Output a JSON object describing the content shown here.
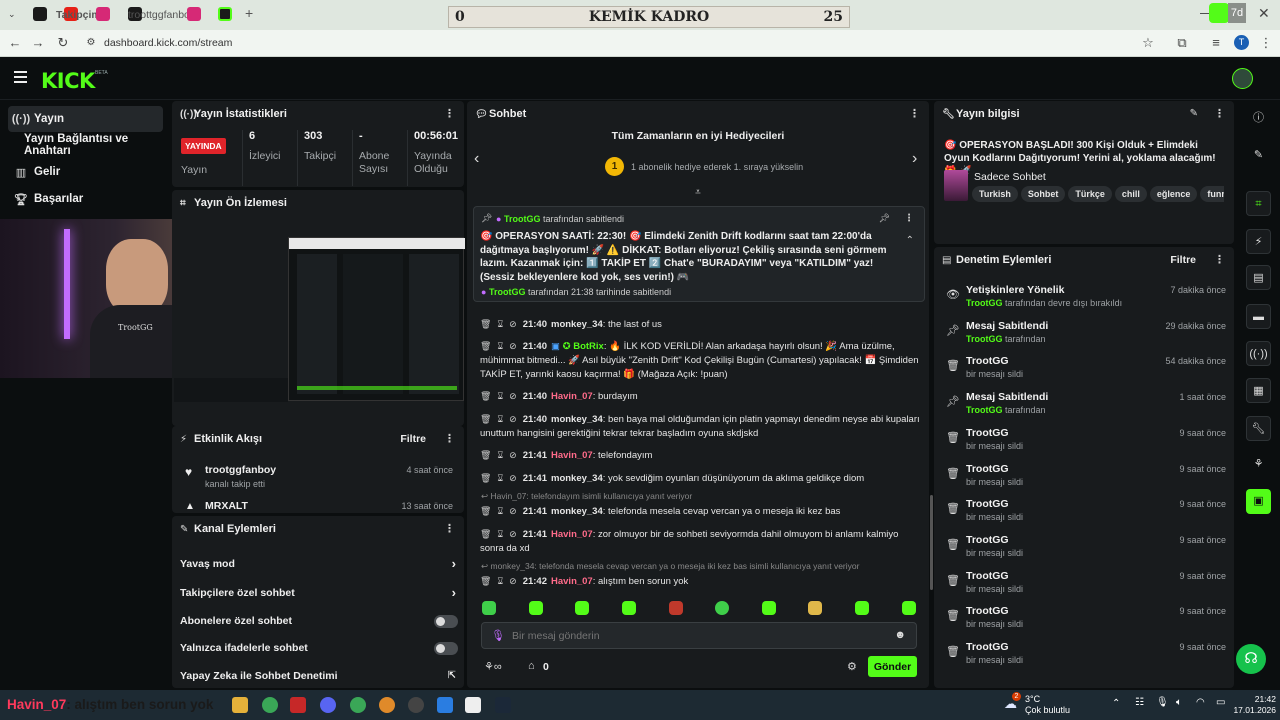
{
  "browser": {
    "tabs": [
      "Takipçimiz",
      "troottggfanboy"
    ],
    "url": "dashboard.kick.com/stream",
    "profile_initial": "T"
  },
  "overlay": {
    "score_left": "0",
    "title": "KEMİK KADRO",
    "score_right": "25"
  },
  "kick": {
    "logo": "KICK",
    "beta": "BETA"
  },
  "nav": {
    "items": [
      {
        "label": "Yayın",
        "icon": "broadcast-icon"
      },
      {
        "label": "Yayın Bağlantısı ve Anahtarı",
        "icon": ""
      },
      {
        "label": "Gelir",
        "icon": "chart-icon"
      },
      {
        "label": "Başarılar",
        "icon": "trophy-icon"
      }
    ]
  },
  "stats": {
    "title": "Yayın İstatistikleri",
    "live_badge": "YAYINDA",
    "live_label": "Yayın",
    "viewers_value": "6",
    "viewers_label": "İzleyici",
    "followers_value": "303",
    "followers_label": "Takipçi",
    "subs_value": "-",
    "subs_label": "Abone Sayısı",
    "uptime_value": "00:56:01",
    "uptime_label": "Yayında Olduğu"
  },
  "preview": {
    "title": "Yayın Ön İzlemesi",
    "webcam_label": "TrootGG"
  },
  "activity": {
    "title": "Etkinlik Akışı",
    "filter": "Filtre",
    "items": [
      {
        "name": "trootggfanboy",
        "desc": "kanalı takip etti",
        "time": "4 saat önce"
      },
      {
        "name": "MRXALT",
        "desc": "",
        "time": "13 saat önce"
      }
    ]
  },
  "channel_actions": {
    "title": "Kanal Eylemleri",
    "rows": [
      "Yavaş mod",
      "Takipçilere özel sohbet",
      "Abonelere özel sohbet",
      "Yalnızca ifadelerle sohbet",
      "Yapay Zeka ile Sohbet Denetimi"
    ]
  },
  "chat": {
    "title": "Sohbet",
    "gifters_title": "Tüm Zamanların en iyi Hediyecileri",
    "gifters_rank": "1",
    "gifters_text": "1 abonelik hediye ederek 1. sıraya yükselin",
    "pinned_by_top": "TrootGG",
    "pinned_by_top_suffix": "tarafından sabitlendi",
    "pinned_text": "🎯 OPERASYON SAATİ: 22:30! 🎯 Elimdeki Zenith Drift kodlarını saat tam 22:00'da dağıtmaya başlıyorum! 🚀 ⚠️ DİKKAT: Botları eliyoruz! Çekiliş sırasında seni görmem lazım. Kazanmak için: 1️⃣ TAKİP ET 2️⃣ Chat'e \"BURADAYIM\" veya \"KATILDIM\" yaz! (Sessiz bekleyenlere kod yok, ses verin!) 🎮",
    "pinned_by_bottom": "TrootGG",
    "pinned_by_bottom_suffix": "tarafından 21:38 tarihinde sabitlendi",
    "messages": [
      {
        "time": "21:40",
        "user": "monkey_34",
        "color": "#e6e6e6",
        "text": "the last of us"
      },
      {
        "time": "21:40",
        "user": "BotRix",
        "color": "#53fc18",
        "text": "🔥 İLK KOD VERİLDİ! Alan arkadaşa hayırlı olsun! 🎉 Ama üzülme, mühimmat bitmedi... 🚀 Asıl büyük \"Zenith Drift\" Kod Çekilişi Bugün (Cumartesi) yapılacak! 📅 Şimdiden TAKİP ET, yarınki kaosu kaçırma! 🎁 (Mağaza Açık: !puan)"
      },
      {
        "time": "21:40",
        "user": "Havin_07",
        "color": "#ff6b8a",
        "text": "burdayım"
      },
      {
        "time": "21:40",
        "user": "monkey_34",
        "color": "#e6e6e6",
        "text": "ben baya mal olduğumdan için platin yapmayı denedim neyse abi kupaları unuttum hangisini gerektiğini tekrar tekrar başladım oyuna skdjskd"
      },
      {
        "time": "21:41",
        "user": "Havin_07",
        "color": "#ff6b8a",
        "text": "telefondayım"
      },
      {
        "time": "21:41",
        "user": "monkey_34",
        "color": "#e6e6e6",
        "text": "yok sevdiğim oyunları düşünüyorum da aklıma geldikçe diom"
      },
      {
        "time": "21:41",
        "user": "monkey_34",
        "color": "#e6e6e6",
        "text": "telefonda mesela cevap vercan ya o meseja iki kez bas"
      },
      {
        "time": "21:41",
        "user": "Havin_07",
        "color": "#ff6b8a",
        "text": "zor olmuyor bir de sohbeti seviyormda dahil olmuyom bi anlamı kalmiyo sonra da xd"
      },
      {
        "time": "21:42",
        "user": "Havin_07",
        "color": "#ff6b8a",
        "text": "alıştım ben sorun yok"
      }
    ],
    "replies": [
      "Havin_07: telefondayım isimli kullanıcıya yanıt veriyor",
      "monkey_34: telefonda mesela cevap vercan ya o meseja iki kez bas isimli kullanıcıya yanıt veriyor"
    ],
    "input_placeholder": "Bir mesaj gönderin",
    "points": "0",
    "send_label": "Gönder"
  },
  "stream_info": {
    "title": "Yayın bilgisi",
    "stream_title": "🎯 OPERASYON BAŞLADI! 300 Kişi Olduk + Elimdeki Oyun Kodlarını Dağıtıyorum! Yerini al, yoklama alacağım! 🎁 🚀",
    "category": "Sadece Sohbet",
    "tags": [
      "Turkish",
      "Sohbet",
      "Türkçe",
      "chill",
      "eğlence",
      "funny"
    ]
  },
  "mod_actions": {
    "title": "Denetim Eylemleri",
    "filter": "Filtre",
    "items": [
      {
        "title": "Yetişkinlere Yönelik",
        "by": "TrootGG",
        "suffix": "tarafından devre dışı bırakıldı",
        "time": "7 dakika önce",
        "icon": "eye-icon"
      },
      {
        "title": "Mesaj Sabitlendi",
        "by": "TrootGG",
        "suffix": "tarafından",
        "time": "29 dakika önce",
        "icon": "pin-icon"
      },
      {
        "title": "TrootGG",
        "by": "",
        "suffix": "bir mesajı sildi",
        "time": "54 dakika önce",
        "icon": "trash-icon"
      },
      {
        "title": "Mesaj Sabitlendi",
        "by": "TrootGG",
        "suffix": "tarafından",
        "time": "1 saat önce",
        "icon": "pin-icon"
      },
      {
        "title": "TrootGG",
        "by": "",
        "suffix": "bir mesajı sildi",
        "time": "9 saat önce",
        "icon": "trash-icon"
      },
      {
        "title": "TrootGG",
        "by": "",
        "suffix": "bir mesajı sildi",
        "time": "9 saat önce",
        "icon": "trash-icon"
      },
      {
        "title": "TrootGG",
        "by": "",
        "suffix": "bir mesajı sildi",
        "time": "9 saat önce",
        "icon": "trash-icon"
      },
      {
        "title": "TrootGG",
        "by": "",
        "suffix": "bir mesajı sildi",
        "time": "9 saat önce",
        "icon": "trash-icon"
      },
      {
        "title": "TrootGG",
        "by": "",
        "suffix": "bir mesajı sildi",
        "time": "9 saat önce",
        "icon": "trash-icon"
      },
      {
        "title": "TrootGG",
        "by": "",
        "suffix": "bir mesajı sildi",
        "time": "9 saat önce",
        "icon": "trash-icon"
      },
      {
        "title": "TrootGG",
        "by": "",
        "suffix": "bir mesajı sildi",
        "time": "9 saat önce",
        "icon": "trash-icon"
      }
    ]
  },
  "overlay_chat": {
    "user": "Havin_07",
    "text": ": alıştım ben sorun yok"
  },
  "taskbar": {
    "weather_temp": "3°C",
    "weather_desc": "Çok bulutlu",
    "weather_badge": "2",
    "time": "21:42",
    "date": "17.01.2026"
  },
  "colors": {
    "kick_green": "#53fc18",
    "live_red": "#e0242a",
    "panel": "#181b1d"
  }
}
